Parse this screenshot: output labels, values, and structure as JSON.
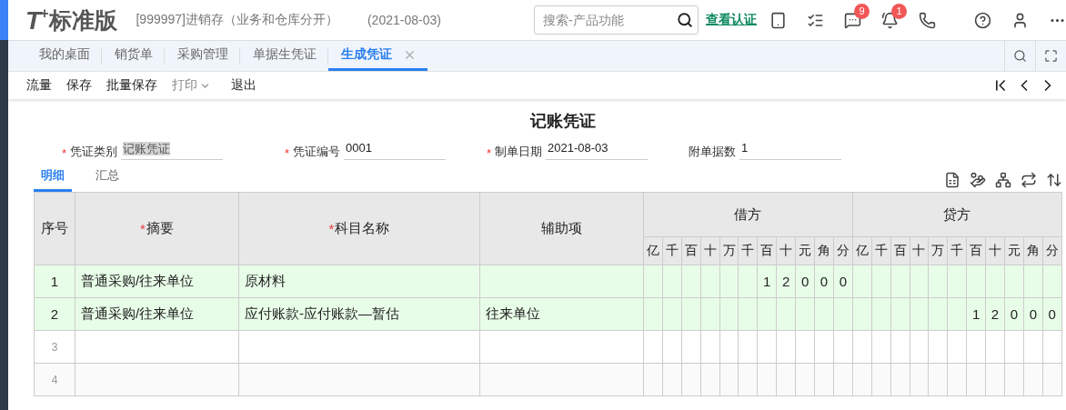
{
  "header": {
    "logo": "T$^{+}$",
    "product": "标准版",
    "account": "[999997]进销存（业务和仓库分开）",
    "date": "(2021-08-03)",
    "search": {
      "placeholder": "搜索-产品功能"
    },
    "link": "查看认证",
    "icons": [
      {
        "kind": "tablet"
      },
      {
        "kind": "checklist"
      },
      {
        "kind": "message",
        "badge": "9"
      },
      {
        "kind": "bell",
        "badge": "1"
      },
      {
        "kind": "phone"
      },
      {
        "kind": "help"
      },
      {
        "kind": "user"
      },
      {
        "kind": "more"
      }
    ]
  },
  "tabs": [
    {
      "label": "我的桌面",
      "selected": false,
      "closable": false
    },
    {
      "label": "销货单",
      "selected": false,
      "closable": false
    },
    {
      "label": "采购管理",
      "selected": false,
      "closable": false
    },
    {
      "label": "单据生凭证",
      "selected": false,
      "closable": false
    },
    {
      "label": "生成凭证",
      "selected": true,
      "closable": true
    }
  ],
  "toolbar": [
    {
      "label": "流量",
      "disabled": false,
      "dropdown": false
    },
    {
      "label": "保存",
      "disabled": false,
      "dropdown": false
    },
    {
      "label": "批量保存",
      "disabled": false,
      "dropdown": false
    },
    {
      "label": "打印",
      "disabled": true,
      "dropdown": true
    },
    {
      "label": "退出",
      "disabled": false,
      "dropdown": false
    }
  ],
  "voucher": {
    "title": "记账凭证",
    "fields": [
      {
        "required_mark": "*",
        "label": "凭证类别",
        "value": "记账凭证",
        "highlighted": true
      },
      {
        "required_mark": "*",
        "label": "凭证编号",
        "value": "0001",
        "highlighted": false
      },
      {
        "required_mark": "*",
        "label": "制单日期",
        "value": "2021-08-03",
        "highlighted": false
      },
      {
        "label": "附单据数",
        "value": "1",
        "highlighted": false
      }
    ],
    "view_tabs": [
      {
        "label": "明细",
        "selected": true
      },
      {
        "label": "汇总",
        "selected": false
      }
    ]
  },
  "table": {
    "columns": [
      {
        "label": "序号"
      },
      {
        "required_mark": "*",
        "label": "摘要"
      },
      {
        "required_mark": "*",
        "label": "科目名称"
      },
      {
        "label": "辅助项"
      }
    ],
    "groups": [
      {
        "label": "借方",
        "digits": [
          "亿",
          "千",
          "百",
          "十",
          "万",
          "千",
          "百",
          "十",
          "元",
          "角",
          "分"
        ]
      },
      {
        "label": "贷方",
        "digits": [
          "亿",
          "千",
          "百",
          "十",
          "万",
          "千",
          "百",
          "十",
          "元",
          "角",
          "分"
        ]
      }
    ],
    "rows": [
      {
        "seq": "1",
        "summary": "普通采购/往来单位",
        "account": "原材料",
        "auxiliary": "",
        "debit": [
          "1",
          "2",
          "0",
          "0",
          "0"
        ],
        "credit": [],
        "filled": true
      },
      {
        "seq": "2",
        "summary": "普通采购/往来单位",
        "account": "应付账款-应付账款—暂估",
        "auxiliary": "往来单位",
        "debit": [],
        "credit": [
          "1",
          "2",
          "0",
          "0",
          "0"
        ],
        "filled": true
      },
      {
        "seq": "3",
        "summary": "",
        "account": "",
        "auxiliary": "",
        "debit": [],
        "credit": [],
        "filled": false
      },
      {
        "seq": "4",
        "summary": "",
        "account": "",
        "auxiliary": "",
        "debit": [],
        "credit": [],
        "filled": false
      }
    ]
  }
}
